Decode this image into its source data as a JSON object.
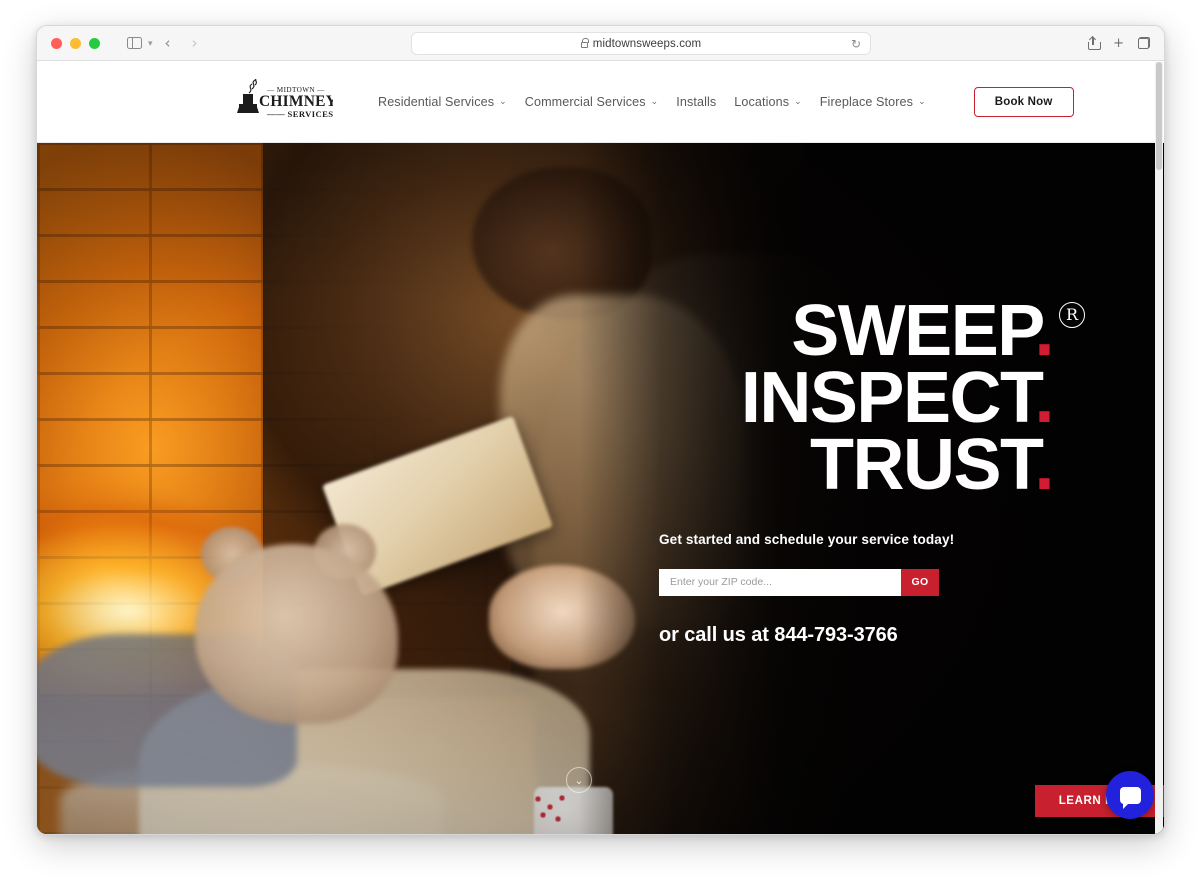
{
  "browser": {
    "url": "midtownsweeps.com",
    "traffic_lights": [
      "close",
      "minimize",
      "maximize"
    ],
    "icons": {
      "sidebar": "sidebar-toggle-icon",
      "sidebar_chevron": "chevron-down-icon",
      "back": "back-arrow-icon",
      "forward": "forward-arrow-icon",
      "lock": "lock-icon",
      "reload": "reload-icon",
      "share": "share-icon",
      "new_tab": "plus-icon",
      "tab_overview": "tab-overview-icon"
    },
    "back_glyph": "‹",
    "forward_glyph": "›",
    "reload_glyph": "↻",
    "plus_glyph": "+"
  },
  "site_header": {
    "logo": {
      "top_text": "MIDTOWN",
      "main_text": "CHIMNEY",
      "bottom_text": "SERVICES",
      "alt": "Midtown Chimney Services logo with top hat"
    },
    "nav": [
      {
        "label": "Residential Services",
        "has_dropdown": true
      },
      {
        "label": "Commercial Services",
        "has_dropdown": true
      },
      {
        "label": "Installs",
        "has_dropdown": false
      },
      {
        "label": "Locations",
        "has_dropdown": true
      },
      {
        "label": "Fireplace Stores",
        "has_dropdown": true
      }
    ],
    "caret_glyph": "⌄",
    "cta_label": "Book Now"
  },
  "hero": {
    "headline": [
      {
        "word": "SWEEP",
        "dot": "."
      },
      {
        "word": "INSPECT",
        "dot": "."
      },
      {
        "word": "TRUST",
        "dot": "."
      }
    ],
    "registered_mark": "R",
    "subheading": "Get started and schedule your service today!",
    "zip_placeholder": "Enter your ZIP code...",
    "zip_value": "",
    "go_label": "GO",
    "call_text": "or call us at 844-793-3766",
    "phone_number": "844-793-3766",
    "scroll_down_glyph": "⌄",
    "learn_more_label": "LEARN MORE",
    "chat_label": "chat-bubble-icon"
  },
  "colors": {
    "brand_red": "#c8202e",
    "dot_red": "#d21c31",
    "chat_blue": "#2222dd",
    "hero_dark": "#050303",
    "nav_text": "#58595b"
  }
}
